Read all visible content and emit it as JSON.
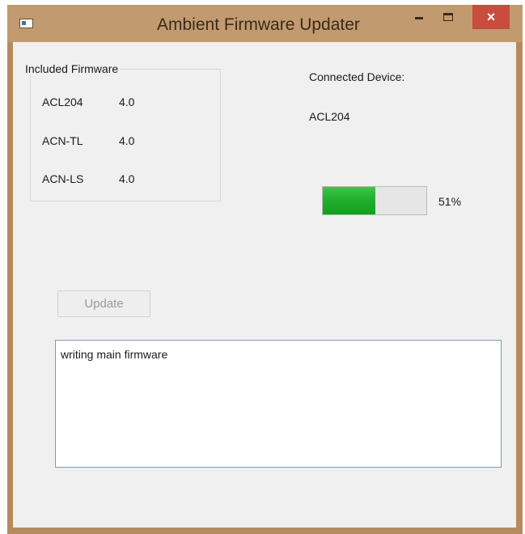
{
  "window": {
    "title": "Ambient Firmware Updater",
    "controls": {
      "minimize": "–",
      "maximize": "□",
      "close": "×"
    }
  },
  "included_firmware": {
    "legend": "Included Firmware",
    "items": [
      {
        "name": "ACL204",
        "version": "4.0"
      },
      {
        "name": "ACN-TL",
        "version": "4.0"
      },
      {
        "name": "ACN-LS",
        "version": "4.0"
      }
    ]
  },
  "connected_device": {
    "label": "Connected Device:",
    "value": "ACL204"
  },
  "progress": {
    "percent_value": 51,
    "percent_text": "51%"
  },
  "update_button": {
    "label": "Update",
    "enabled": false
  },
  "log": {
    "text": "writing main firmware"
  },
  "colors": {
    "titlebar": "#c19a70",
    "close": "#c84c3f",
    "progress_fill": "#1fae2c"
  }
}
